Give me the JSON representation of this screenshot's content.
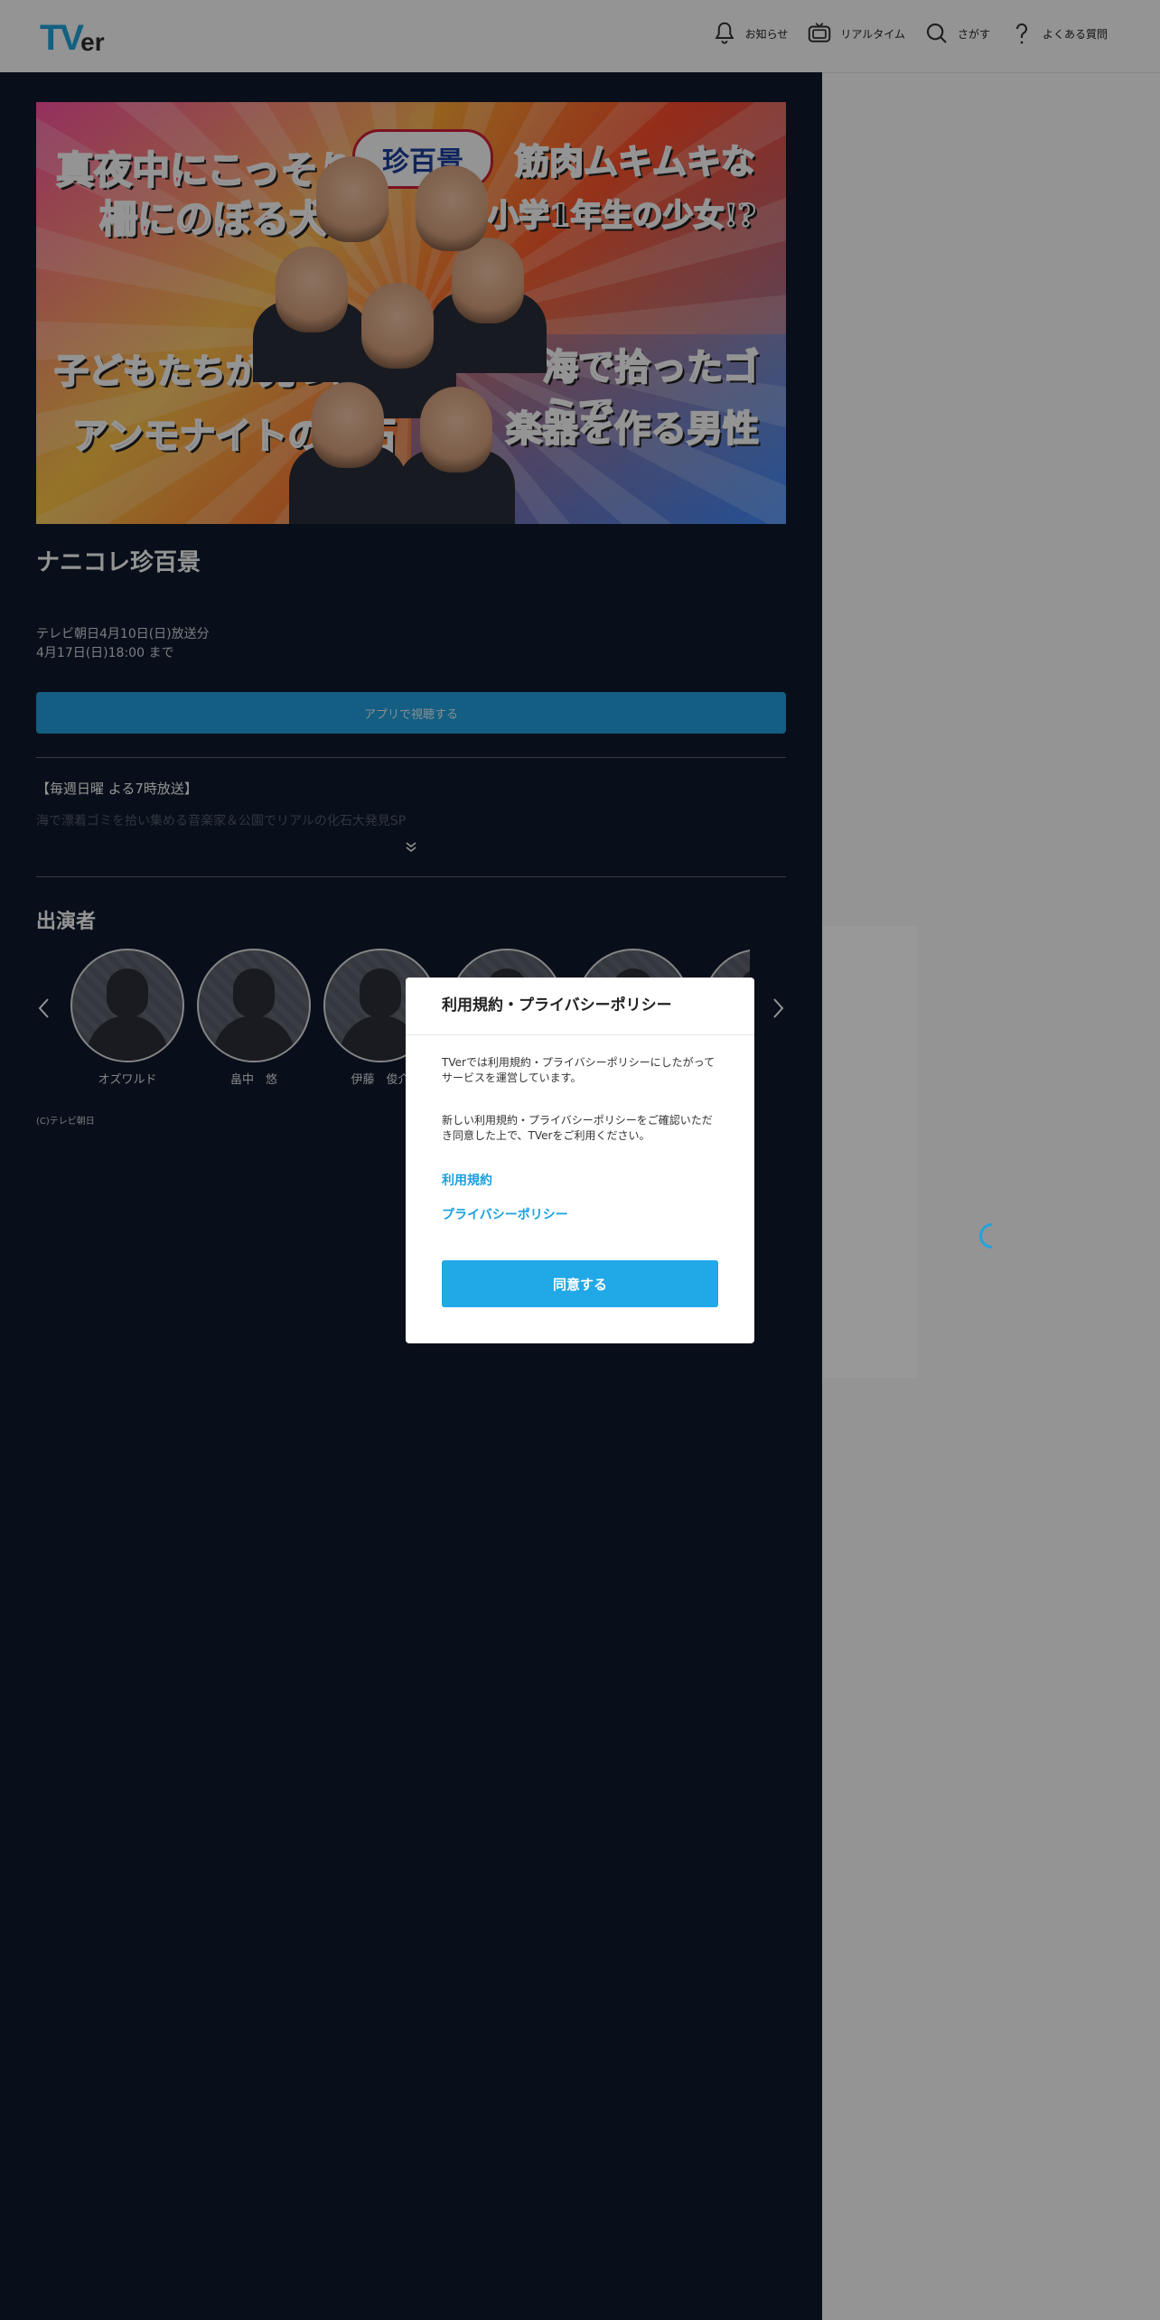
{
  "header": {
    "logo_big": "TV",
    "logo_small": "er",
    "nav": [
      {
        "label": "お知らせ",
        "icon": "bell-icon"
      },
      {
        "label": "リアルタイム",
        "icon": "tv-icon"
      },
      {
        "label": "さがす",
        "icon": "search-icon"
      },
      {
        "label": "よくある質問",
        "icon": "question-icon"
      }
    ]
  },
  "episode": {
    "thumbnail": {
      "logo_text": "珍百景",
      "captions": [
        "真夜中にこっそり",
        "柵にのぼる犬",
        "筋肉ムキムキな",
        "小学1年生の少女!?",
        "子どもたちが見つけた",
        "アンモナイトの化石",
        "海で拾ったゴミで",
        "楽器を作る男性"
      ]
    },
    "title": "ナニコレ珍百景",
    "broadcast_date": "テレビ朝日4月10日(日)放送分",
    "available_until": "4月17日(日)18:00 まで",
    "app_button": "アプリで視聴する",
    "desc_line1": "【毎週日曜 よる7時放送】",
    "desc_line2": "海で漂着ゴミを拾い集める音楽家＆公園でリアルの化石大発見SP"
  },
  "cast": {
    "heading": "出演者",
    "members": [
      {
        "name": "オズワルド"
      },
      {
        "name": "畠中　悠"
      },
      {
        "name": "伊藤　俊介"
      },
      {
        "name": ""
      },
      {
        "name": ""
      },
      {
        "name": ""
      }
    ]
  },
  "copyright": "(C)テレビ朝日",
  "modal": {
    "title": "利用規約・プライバシーポリシー",
    "text1": "TVerでは利用規約・プライバシーポリシーにしたがってサービスを運営しています。",
    "text2": "新しい利用規約・プライバシーポリシーをご確認いただき同意した上で、TVerをご利用ください。",
    "link_terms": "利用規約",
    "link_privacy": "プライバシーポリシー",
    "agree_button": "同意する"
  },
  "colors": {
    "accent": "#21a8e7",
    "main_bg": "#0f1a2d"
  }
}
